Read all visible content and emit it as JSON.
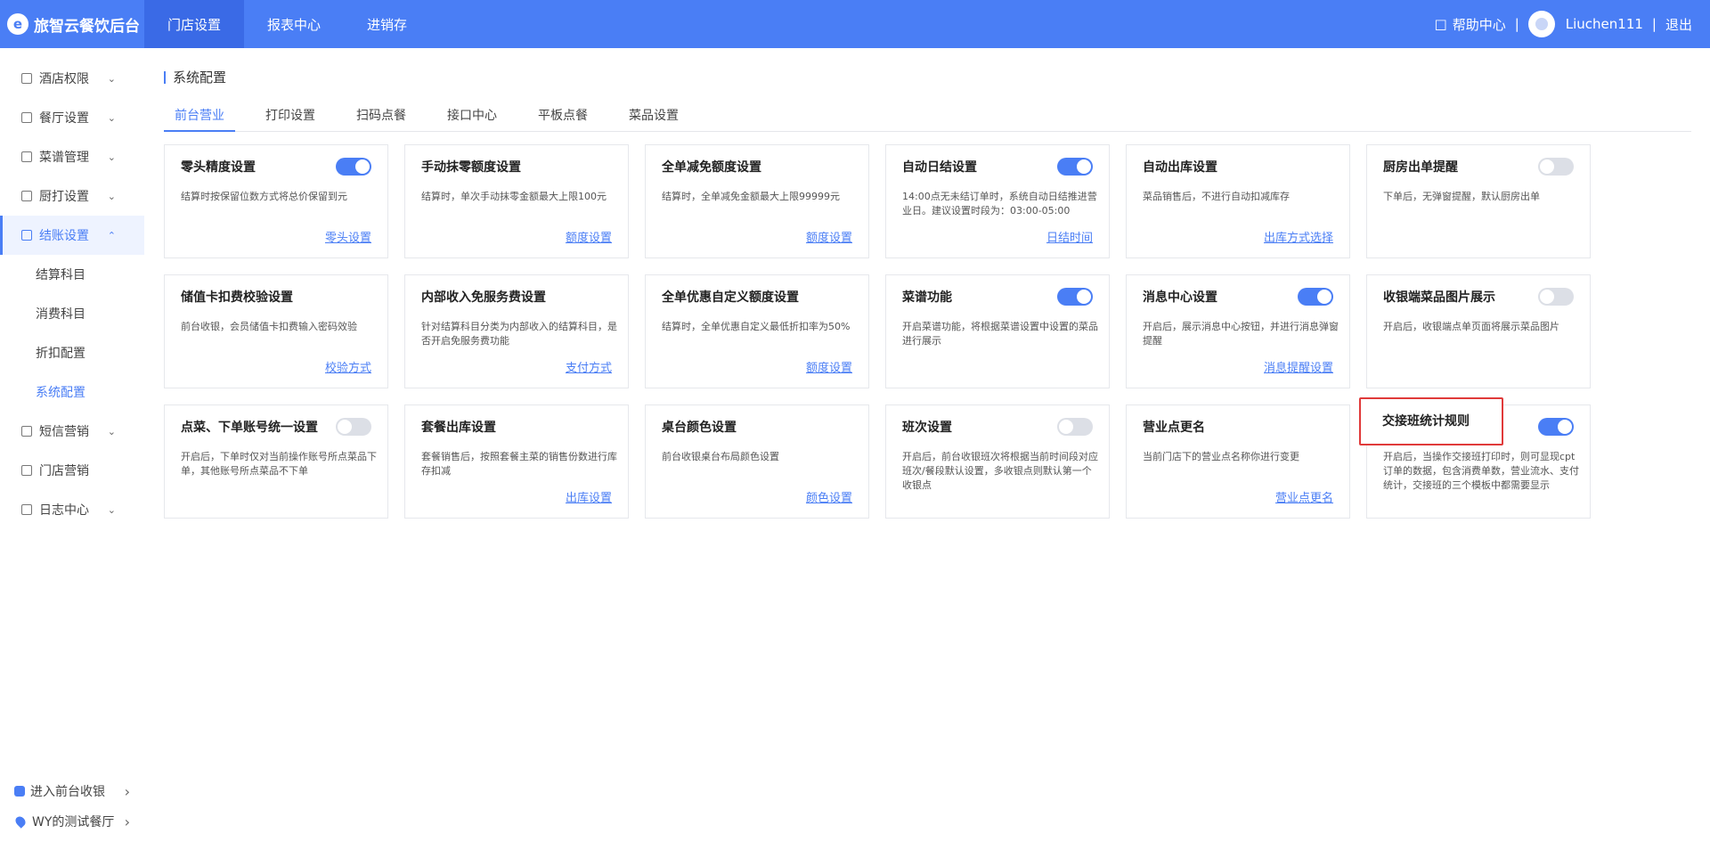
{
  "brand": {
    "name": "旅智云餐饮后台"
  },
  "topnav": [
    {
      "label": "门店设置"
    },
    {
      "label": "报表中心"
    },
    {
      "label": "进销存"
    }
  ],
  "topright": {
    "help": "帮助中心",
    "sep1": "|",
    "username": "Liuchen111",
    "sep2": "|",
    "logout": "退出"
  },
  "sidebar": {
    "items": [
      {
        "label": "酒店权限"
      },
      {
        "label": "餐厅设置"
      },
      {
        "label": "菜谱管理"
      },
      {
        "label": "厨打设置"
      },
      {
        "label": "结账设置"
      },
      {
        "label": "短信营销"
      },
      {
        "label": "门店营销"
      },
      {
        "label": "日志中心"
      }
    ],
    "subitems": [
      {
        "label": "结算科目"
      },
      {
        "label": "消费科目"
      },
      {
        "label": "折扣配置"
      },
      {
        "label": "系统配置"
      }
    ],
    "bottom": [
      {
        "label": "进入前台收银"
      },
      {
        "label": "WY的测试餐厅"
      }
    ]
  },
  "main": {
    "title": "系统配置",
    "tabs": [
      {
        "label": "前台营业"
      },
      {
        "label": "打印设置"
      },
      {
        "label": "扫码点餐"
      },
      {
        "label": "接口中心"
      },
      {
        "label": "平板点餐"
      },
      {
        "label": "菜品设置"
      }
    ],
    "cards": [
      {
        "title": "零头精度设置",
        "desc": "结算时按保留位数方式将总价保留到元",
        "link": "零头设置",
        "toggle": "on"
      },
      {
        "title": "手动抹零额度设置",
        "desc": "结算时，单次手动抹零金额最大上限100元",
        "link": "额度设置"
      },
      {
        "title": "全单减免额度设置",
        "desc": "结算时，全单减免金额最大上限99999元",
        "link": "额度设置"
      },
      {
        "title": "自动日结设置",
        "desc": "14:00点无未结订单时，系统自动日结推进营业日。建议设置时段为：03:00-05:00",
        "link": "日结时间",
        "toggle": "on"
      },
      {
        "title": "自动出库设置",
        "desc": "菜品销售后，不进行自动扣减库存",
        "link": "出库方式选择"
      },
      {
        "title": "厨房出单提醒",
        "desc": "下单后，无弹窗提醒，默认厨房出单",
        "toggle": "off"
      },
      {
        "title": "储值卡扣费校验设置",
        "desc": "前台收银，会员储值卡扣费输入密码效验",
        "link": "校验方式"
      },
      {
        "title": "内部收入免服务费设置",
        "desc": "针对结算科目分类为内部收入的结算科目，是否开启免服务费功能",
        "link": "支付方式"
      },
      {
        "title": "全单优惠自定义额度设置",
        "desc": "结算时，全单优惠自定义最低折扣率为50%",
        "link": "额度设置"
      },
      {
        "title": "菜谱功能",
        "desc": "开启菜谱功能，将根据菜谱设置中设置的菜品进行展示",
        "toggle": "on"
      },
      {
        "title": "消息中心设置",
        "desc": "开启后，展示消息中心按钮，并进行消息弹窗提醒",
        "link": "消息提醒设置",
        "toggle": "on"
      },
      {
        "title": "收银端菜品图片展示",
        "desc": "开启后，收银端点单页面将展示菜品图片",
        "toggle": "off"
      },
      {
        "title": "点菜、下单账号统一设置",
        "desc": "开启后，下单时仅对当前操作账号所点菜品下单，其他账号所点菜品不下单",
        "toggle": "off"
      },
      {
        "title": "套餐出库设置",
        "desc": "套餐销售后，按照套餐主菜的销售份数进行库存扣减",
        "link": "出库设置"
      },
      {
        "title": "桌台颜色设置",
        "desc": "前台收银桌台布局颜色设置",
        "link": "颜色设置"
      },
      {
        "title": "班次设置",
        "desc": "开启后，前台收银班次将根据当前时间段对应班次/餐段默认设置，多收银点则默认第一个收银点",
        "toggle": "off"
      },
      {
        "title": "营业点更名",
        "desc": "当前门店下的营业点名称你进行变更",
        "link": "营业点更名"
      },
      {
        "title": "交接班统计规则",
        "desc": "开启后，当操作交接班打印时，则可显现cpt订单的数据，包含消费单数，营业流水、支付统计，交接班的三个模板中都需要显示",
        "toggle": "on"
      }
    ]
  },
  "colors": {
    "primary": "#4a7ef5",
    "highlight": "#e03a3a"
  }
}
